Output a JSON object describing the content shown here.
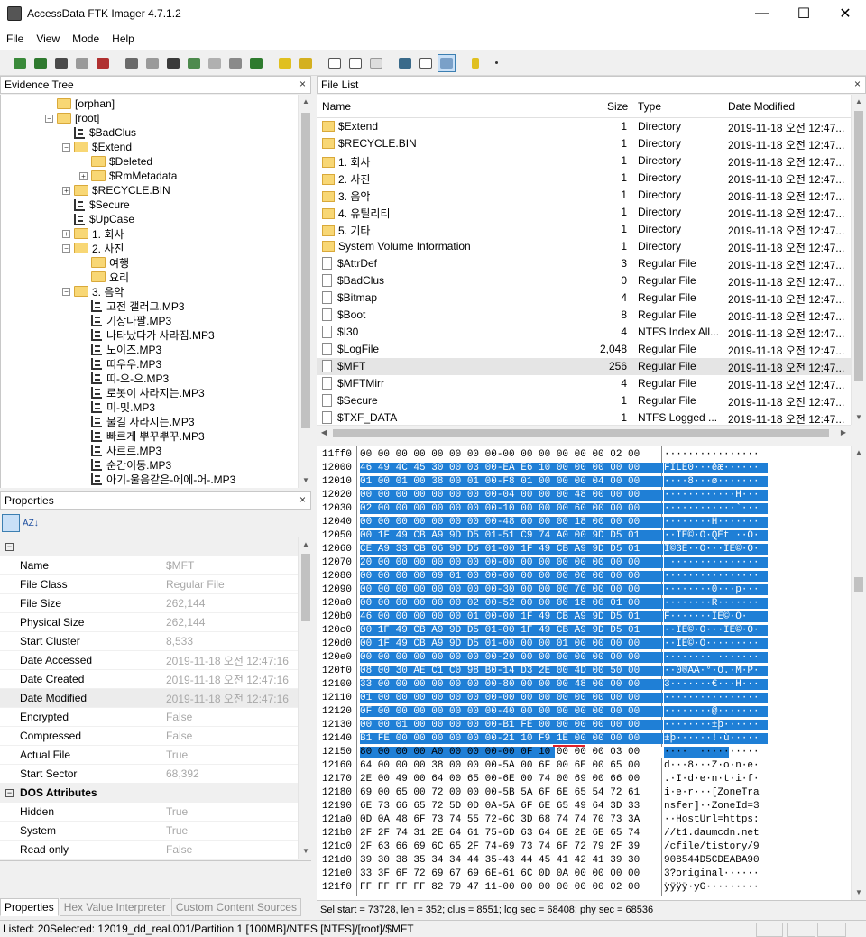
{
  "window": {
    "title": "AccessData FTK Imager 4.7.1.2",
    "minimize": "—",
    "maximize": "☐",
    "close": "✕"
  },
  "menu": [
    "File",
    "View",
    "Mode",
    "Help"
  ],
  "evidence_tree": {
    "title": "Evidence Tree",
    "close": "×",
    "items": [
      {
        "label": "[orphan]",
        "level": 4,
        "kind": "folder",
        "expander": ""
      },
      {
        "label": "[root]",
        "level": 4,
        "kind": "folder",
        "expander": "−"
      },
      {
        "label": "$BadClus",
        "level": 5,
        "kind": "file",
        "expander": ""
      },
      {
        "label": "$Extend",
        "level": 5,
        "kind": "folder",
        "expander": "−"
      },
      {
        "label": "$Deleted",
        "level": 6,
        "kind": "folder",
        "expander": ""
      },
      {
        "label": "$RmMetadata",
        "level": 6,
        "kind": "folder",
        "expander": "+"
      },
      {
        "label": "$RECYCLE.BIN",
        "level": 5,
        "kind": "folder",
        "expander": "+"
      },
      {
        "label": "$Secure",
        "level": 5,
        "kind": "file",
        "expander": ""
      },
      {
        "label": "$UpCase",
        "level": 5,
        "kind": "file",
        "expander": ""
      },
      {
        "label": "1. 회사",
        "level": 5,
        "kind": "folder",
        "expander": "+"
      },
      {
        "label": "2. 사진",
        "level": 5,
        "kind": "folder",
        "expander": "−"
      },
      {
        "label": "여행",
        "level": 6,
        "kind": "folder",
        "expander": ""
      },
      {
        "label": "요리",
        "level": 6,
        "kind": "folder",
        "expander": ""
      },
      {
        "label": "3. 음악",
        "level": 5,
        "kind": "folder",
        "expander": "−"
      },
      {
        "label": "고전 갤러그.MP3",
        "level": 6,
        "kind": "file",
        "expander": ""
      },
      {
        "label": "기상나팔.MP3",
        "level": 6,
        "kind": "file",
        "expander": ""
      },
      {
        "label": "나타났다가 사라짐.MP3",
        "level": 6,
        "kind": "file",
        "expander": ""
      },
      {
        "label": "노이즈.MP3",
        "level": 6,
        "kind": "file",
        "expander": ""
      },
      {
        "label": "띠우우.MP3",
        "level": 6,
        "kind": "file",
        "expander": ""
      },
      {
        "label": "띠-으-으.MP3",
        "level": 6,
        "kind": "file",
        "expander": ""
      },
      {
        "label": "로봇이 사라지는.MP3",
        "level": 6,
        "kind": "file",
        "expander": ""
      },
      {
        "label": "미-밋.MP3",
        "level": 6,
        "kind": "file",
        "expander": ""
      },
      {
        "label": "불길 사라지는.MP3",
        "level": 6,
        "kind": "file",
        "expander": ""
      },
      {
        "label": "빠르게 뿌꾸뿌꾸.MP3",
        "level": 6,
        "kind": "file",
        "expander": ""
      },
      {
        "label": "사르르.MP3",
        "level": 6,
        "kind": "file",
        "expander": ""
      },
      {
        "label": "순간이동.MP3",
        "level": 6,
        "kind": "file",
        "expander": ""
      },
      {
        "label": "아기-울음같은-에에-어-.MP3",
        "level": 6,
        "kind": "file",
        "expander": ""
      }
    ]
  },
  "properties": {
    "title": "Properties",
    "close": "×",
    "sort_alpha": "AZ↓",
    "rows": [
      {
        "type": "category",
        "box": "−",
        "name": ""
      },
      {
        "type": "prop",
        "name": "Name",
        "value": "$MFT"
      },
      {
        "type": "prop",
        "name": "File Class",
        "value": "Regular File"
      },
      {
        "type": "prop",
        "name": "File Size",
        "value": "262,144"
      },
      {
        "type": "prop",
        "name": "Physical Size",
        "value": "262,144"
      },
      {
        "type": "prop",
        "name": "Start Cluster",
        "value": "8,533"
      },
      {
        "type": "prop",
        "name": "Date Accessed",
        "value": "2019-11-18 오전 12:47:16"
      },
      {
        "type": "prop",
        "name": "Date Created",
        "value": "2019-11-18 오전 12:47:16"
      },
      {
        "type": "prop",
        "name": "Date Modified",
        "value": "2019-11-18 오전 12:47:16",
        "highlight": true
      },
      {
        "type": "prop",
        "name": "Encrypted",
        "value": "False"
      },
      {
        "type": "prop",
        "name": "Compressed",
        "value": "False"
      },
      {
        "type": "prop",
        "name": "Actual File",
        "value": "True"
      },
      {
        "type": "prop",
        "name": "Start Sector",
        "value": "68,392"
      },
      {
        "type": "category",
        "box": "−",
        "name": "DOS Attributes"
      },
      {
        "type": "prop",
        "name": "Hidden",
        "value": "True"
      },
      {
        "type": "prop",
        "name": "System",
        "value": "True"
      },
      {
        "type": "prop",
        "name": "Read only",
        "value": "False"
      }
    ],
    "tabs": [
      "Properties",
      "Hex Value Interpreter",
      "Custom Content Sources"
    ]
  },
  "file_list": {
    "title": "File List",
    "close": "×",
    "columns": [
      "Name",
      "Size",
      "Type",
      "Date Modified"
    ],
    "rows": [
      {
        "name": "$Extend",
        "size": "1",
        "type": "Directory",
        "date": "2019-11-18 오전 12:47...",
        "kind": "folder"
      },
      {
        "name": "$RECYCLE.BIN",
        "size": "1",
        "type": "Directory",
        "date": "2019-11-18 오전 12:47...",
        "kind": "folder"
      },
      {
        "name": "1. 회사",
        "size": "1",
        "type": "Directory",
        "date": "2019-11-18 오전 12:47...",
        "kind": "folder"
      },
      {
        "name": "2. 사진",
        "size": "1",
        "type": "Directory",
        "date": "2019-11-18 오전 12:47...",
        "kind": "folder"
      },
      {
        "name": "3. 음악",
        "size": "1",
        "type": "Directory",
        "date": "2019-11-18 오전 12:47...",
        "kind": "folder"
      },
      {
        "name": "4. 유틸리티",
        "size": "1",
        "type": "Directory",
        "date": "2019-11-18 오전 12:47...",
        "kind": "folder"
      },
      {
        "name": "5. 기타",
        "size": "1",
        "type": "Directory",
        "date": "2019-11-18 오전 12:47...",
        "kind": "folder"
      },
      {
        "name": "System Volume Information",
        "size": "1",
        "type": "Directory",
        "date": "2019-11-18 오전 12:47...",
        "kind": "folder"
      },
      {
        "name": "$AttrDef",
        "size": "3",
        "type": "Regular File",
        "date": "2019-11-18 오전 12:47...",
        "kind": "file"
      },
      {
        "name": "$BadClus",
        "size": "0",
        "type": "Regular File",
        "date": "2019-11-18 오전 12:47...",
        "kind": "file"
      },
      {
        "name": "$Bitmap",
        "size": "4",
        "type": "Regular File",
        "date": "2019-11-18 오전 12:47...",
        "kind": "file"
      },
      {
        "name": "$Boot",
        "size": "8",
        "type": "Regular File",
        "date": "2019-11-18 오전 12:47...",
        "kind": "file"
      },
      {
        "name": "$I30",
        "size": "4",
        "type": "NTFS Index All...",
        "date": "2019-11-18 오전 12:47...",
        "kind": "file"
      },
      {
        "name": "$LogFile",
        "size": "2,048",
        "type": "Regular File",
        "date": "2019-11-18 오전 12:47...",
        "kind": "file"
      },
      {
        "name": "$MFT",
        "size": "256",
        "type": "Regular File",
        "date": "2019-11-18 오전 12:47...",
        "kind": "file",
        "selected": true
      },
      {
        "name": "$MFTMirr",
        "size": "4",
        "type": "Regular File",
        "date": "2019-11-18 오전 12:47...",
        "kind": "file"
      },
      {
        "name": "$Secure",
        "size": "1",
        "type": "Regular File",
        "date": "2019-11-18 오전 12:47...",
        "kind": "file"
      },
      {
        "name": "$TXF_DATA",
        "size": "1",
        "type": "NTFS Logged ...",
        "date": "2019-11-18 오전 12:47...",
        "kind": "file"
      }
    ]
  },
  "hex_view": {
    "rows": [
      {
        "off": "11ff0",
        "bytes": "00 00 00 00 00 00 00 00-00 00 00 00 00 00 02 00",
        "ascii": "················",
        "sel": ""
      },
      {
        "off": "12000",
        "bytes": "46 49 4C 45 30 00 03 00-EA E6 10 00 00 00 00 00",
        "ascii": "FILE0···êæ······",
        "sel": "full"
      },
      {
        "off": "12010",
        "bytes": "01 00 01 00 38 00 01 00-F8 01 00 00 00 04 00 00",
        "ascii": "····8···ø·······",
        "sel": "full"
      },
      {
        "off": "12020",
        "bytes": "00 00 00 00 00 00 00 00-04 00 00 00 48 00 00 00",
        "ascii": "············H···",
        "sel": "full"
      },
      {
        "off": "12030",
        "bytes": "02 00 00 00 00 00 00 00-10 00 00 00 60 00 00 00",
        "ascii": "············`···",
        "sel": "full"
      },
      {
        "off": "12040",
        "bytes": "00 00 00 00 00 00 00 00-48 00 00 00 18 00 00 00",
        "ascii": "········H·······",
        "sel": "full"
      },
      {
        "off": "12050",
        "bytes": "00 1F 49 CB A9 9D D5 01-51 C9 74 A0 00 9D D5 01",
        "ascii": "··IË©·Õ·QÉt ··Õ·",
        "sel": "full"
      },
      {
        "off": "12060",
        "bytes": "CE A9 33 CB 06 9D D5 01-00 1F 49 CB A9 9D D5 01",
        "ascii": "Î©3Ë··Õ···IË©·Õ·",
        "sel": "full"
      },
      {
        "off": "12070",
        "bytes": "20 00 00 00 00 00 00 00-00 00 00 00 00 00 00 00",
        "ascii": " ···············",
        "sel": "full"
      },
      {
        "off": "12080",
        "bytes": "00 00 00 00 09 01 00 00-00 00 00 00 00 00 00 00",
        "ascii": "················",
        "sel": "full"
      },
      {
        "off": "12090",
        "bytes": "00 00 00 00 00 00 00 00-30 00 00 00 70 00 00 00",
        "ascii": "········0···p···",
        "sel": "full"
      },
      {
        "off": "120a0",
        "bytes": "00 00 00 00 00 00 02 00-52 00 00 00 18 00 01 00",
        "ascii": "········R·······",
        "sel": "full"
      },
      {
        "off": "120b0",
        "bytes": "46 00 00 00 00 00 01 00-00 1F 49 CB A9 9D D5 01",
        "ascii": "F·······IË©·Õ·",
        "sel": "full"
      },
      {
        "off": "120c0",
        "bytes": "00 1F 49 CB A9 9D D5 01-00 1F 49 CB A9 9D D5 01",
        "ascii": "··IË©·Õ···IË©·Õ·",
        "sel": "full"
      },
      {
        "off": "120d0",
        "bytes": "00 1F 49 CB A9 9D D5 01-00 00 00 01 00 00 00 00",
        "ascii": "··IË©·Õ·········",
        "sel": "full"
      },
      {
        "off": "120e0",
        "bytes": "00 00 00 00 00 00 00 00-20 00 00 00 00 00 00 00",
        "ascii": "········ ·······",
        "sel": "full"
      },
      {
        "off": "120f0",
        "bytes": "08 00 30 AE C1 C0 98 B0-14 D3 2E 00 4D 00 50 00",
        "ascii": "··0®ÁÀ·°·Ó.·M·P·",
        "sel": "full"
      },
      {
        "off": "12100",
        "bytes": "33 00 00 00 00 00 00 00-80 00 00 00 48 00 00 00",
        "ascii": "3·······€···H···",
        "sel": "full"
      },
      {
        "off": "12110",
        "bytes": "01 00 00 00 00 00 00 00-00 00 00 00 00 00 00 00",
        "ascii": "················",
        "sel": "full"
      },
      {
        "off": "12120",
        "bytes": "0F 00 00 00 00 00 00 00-40 00 00 00 00 00 00 00",
        "ascii": "········@·······",
        "sel": "full"
      },
      {
        "off": "12130",
        "bytes": "00 00 01 00 00 00 00 00-B1 FE 00 00 00 00 00 00",
        "ascii": "········±þ······",
        "sel": "full"
      },
      {
        "off": "12140",
        "bytes": "B1 FE 00 00 00 00 00 00-21 10 F9 1E 00 00 00 00",
        "ascii": "±þ······!·ù·····",
        "sel": "full"
      },
      {
        "off": "12150",
        "bytes": "80 00 00 00 A0 00 00 00-00 0F 10 00 00 00 03 00",
        "ascii": "····  ··········",
        "sel": "partial"
      },
      {
        "off": "12160",
        "bytes": "64 00 00 00 38 00 00 00-5A 00 6F 00 6E 00 65 00",
        "ascii": "d···8···Z·o·n·e·",
        "sel": ""
      },
      {
        "off": "12170",
        "bytes": "2E 00 49 00 64 00 65 00-6E 00 74 00 69 00 66 00",
        "ascii": ".·I·d·e·n·t·i·f·",
        "sel": ""
      },
      {
        "off": "12180",
        "bytes": "69 00 65 00 72 00 00 00-5B 5A 6F 6E 65 54 72 61",
        "ascii": "i·e·r···[ZoneTra",
        "sel": ""
      },
      {
        "off": "12190",
        "bytes": "6E 73 66 65 72 5D 0D 0A-5A 6F 6E 65 49 64 3D 33",
        "ascii": "nsfer]··ZoneId=3",
        "sel": ""
      },
      {
        "off": "121a0",
        "bytes": "0D 0A 48 6F 73 74 55 72-6C 3D 68 74 74 70 73 3A",
        "ascii": "··HostUrl=https:",
        "sel": ""
      },
      {
        "off": "121b0",
        "bytes": "2F 2F 74 31 2E 64 61 75-6D 63 64 6E 2E 6E 65 74",
        "ascii": "//t1.daumcdn.net",
        "sel": ""
      },
      {
        "off": "121c0",
        "bytes": "2F 63 66 69 6C 65 2F 74-69 73 74 6F 72 79 2F 39",
        "ascii": "/cfile/tistory/9",
        "sel": ""
      },
      {
        "off": "121d0",
        "bytes": "39 30 38 35 34 34 44 35-43 44 45 41 42 41 39 30",
        "ascii": "908544D5CDEABA90",
        "sel": ""
      },
      {
        "off": "121e0",
        "bytes": "33 3F 6F 72 69 67 69 6E-61 6C 0D 0A 00 00 00 00",
        "ascii": "3?original······",
        "sel": ""
      },
      {
        "off": "121f0",
        "bytes": "FF FF FF FF 82 79 47 11-00 00 00 00 00 00 02 00",
        "ascii": "ÿÿÿÿ·yG·········",
        "sel": ""
      }
    ],
    "status": "Sel start = 73728, len = 352; clus = 8551; log sec = 68408; phy sec = 68536"
  },
  "statusbar": "Listed: 20Selected: 12019_dd_real.001/Partition 1 [100MB]/NTFS [NTFS]/[root]/$MFT"
}
